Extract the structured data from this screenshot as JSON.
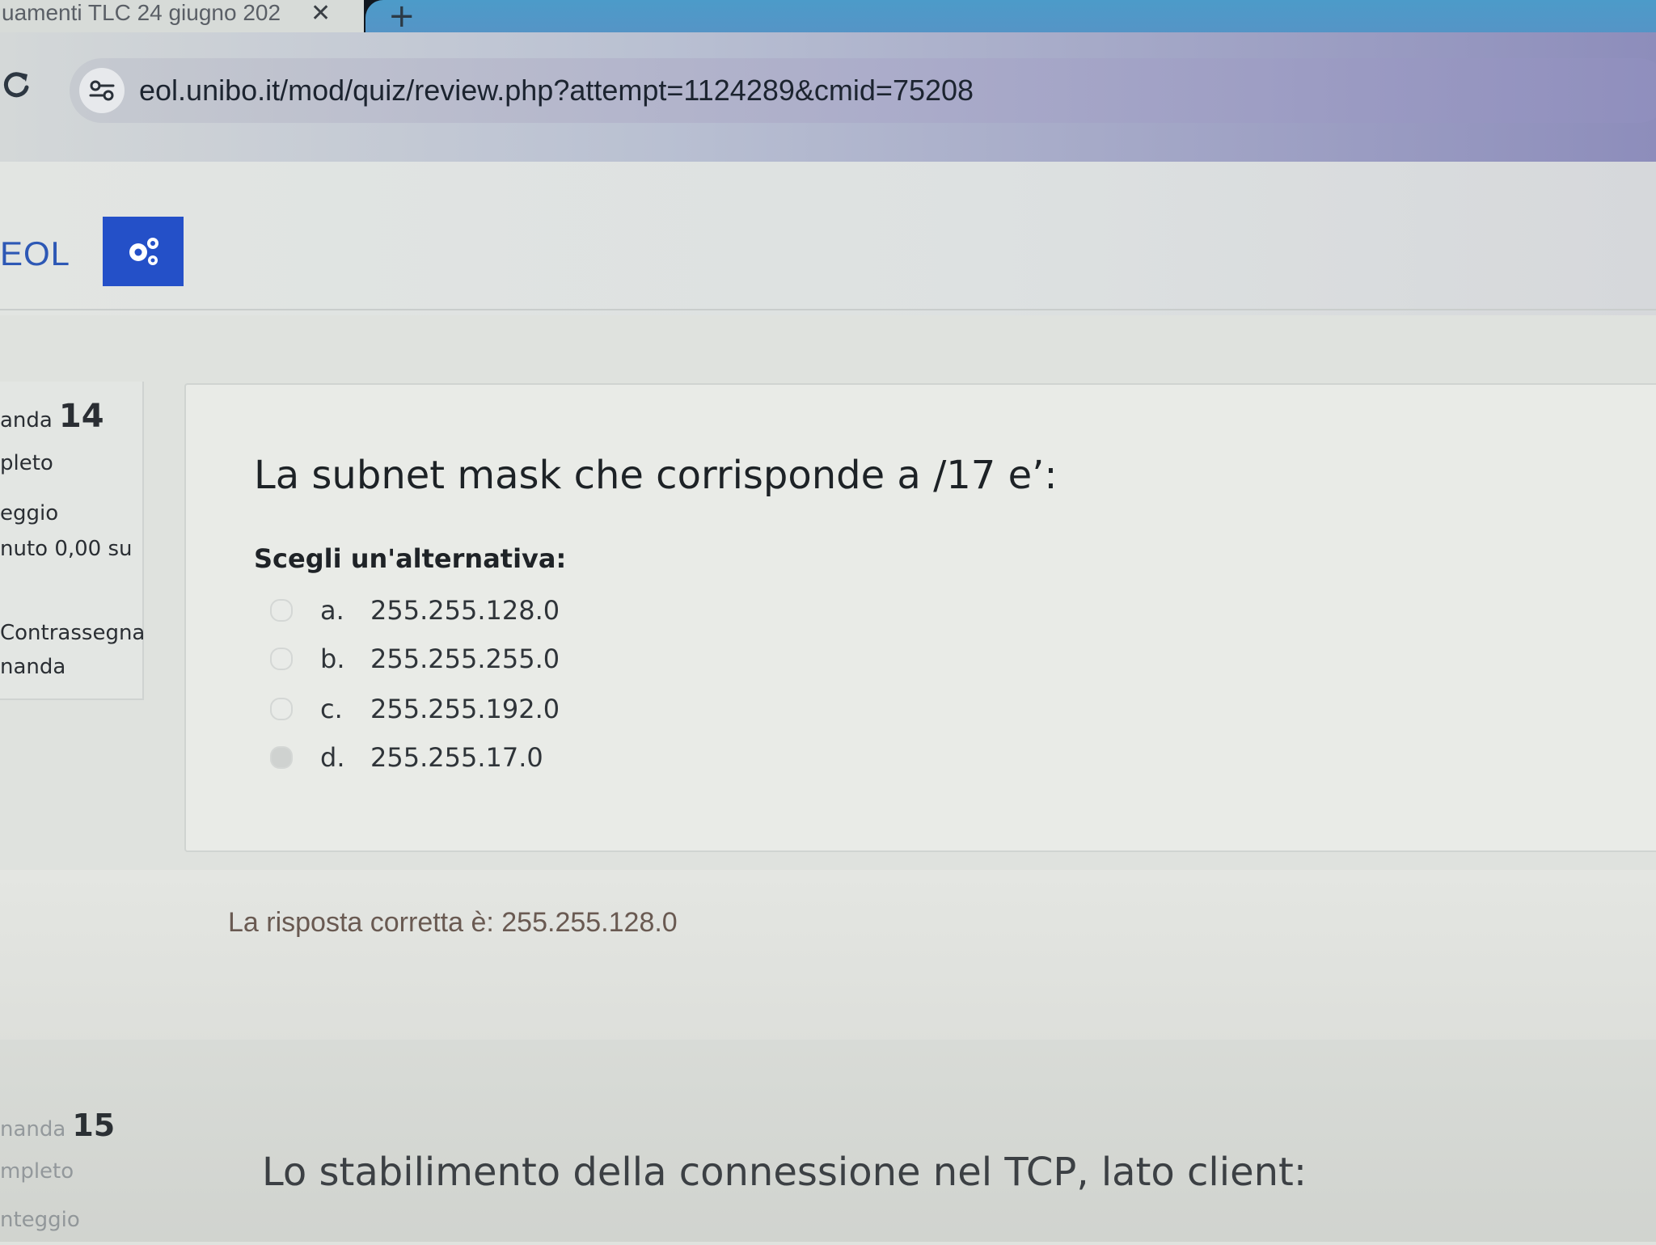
{
  "browser": {
    "tab_title": "uamenti TLC 24 giugno 202",
    "tab_close_label": "✕",
    "new_tab_label": "+",
    "url": "eol.unibo.it/mod/quiz/review.php?attempt=1124289&cmid=75208"
  },
  "header": {
    "brand": "EOL"
  },
  "question14": {
    "info": {
      "label_prefix": "anda",
      "number": "14",
      "state": "pleto",
      "grade_label": "eggio",
      "grade_value": "nuto 0,00 su",
      "flag_line1": "Contrassegna",
      "flag_line2": "nanda"
    },
    "text": "La subnet mask che corrisponde a /17 e’:",
    "prompt": "Scegli un'alternativa:",
    "answers": [
      {
        "letter": "a.",
        "value": "255.255.128.0",
        "selected": false
      },
      {
        "letter": "b.",
        "value": "255.255.255.0",
        "selected": false
      },
      {
        "letter": "c.",
        "value": "255.255.192.0",
        "selected": false
      },
      {
        "letter": "d.",
        "value": "255.255.17.0",
        "selected": true
      }
    ],
    "feedback": "La risposta corretta è: 255.255.128.0"
  },
  "question15": {
    "info": {
      "label_prefix": "nanda",
      "number": "15",
      "state": "mpleto",
      "grade_label": "nteggio"
    },
    "text": "Lo stabilimento della connessione nel TCP, lato client:"
  },
  "colors": {
    "brand_blue": "#2d58b5",
    "admin_button": "#2450c8",
    "feedback_text": "#6a5a52"
  }
}
